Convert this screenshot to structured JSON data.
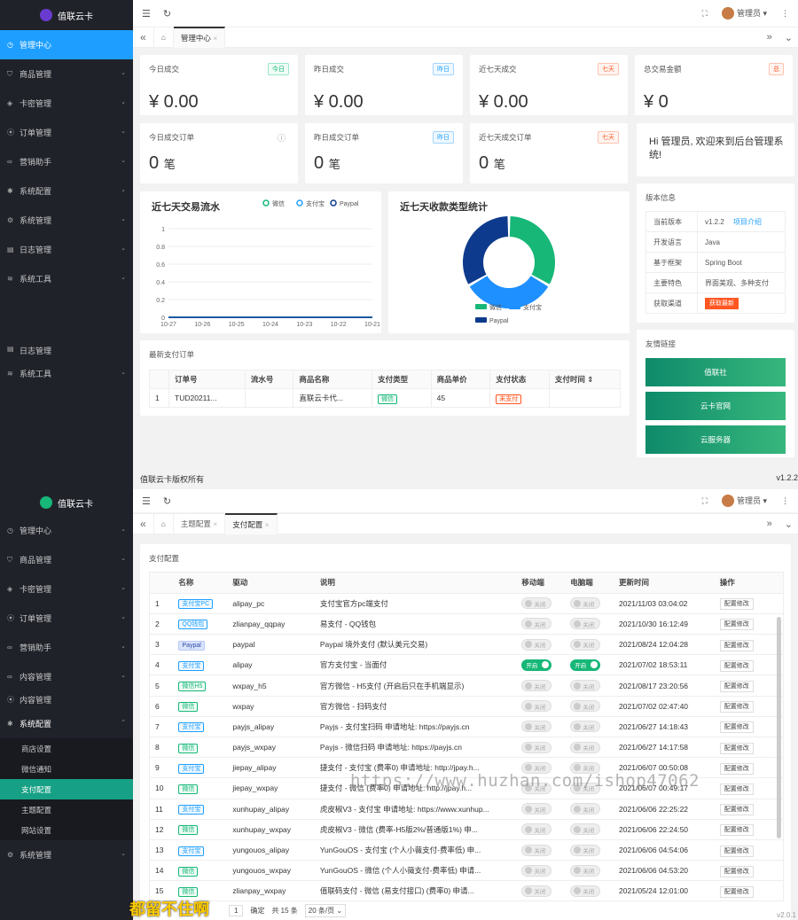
{
  "p1": {
    "brand": "值联云卡",
    "nav": [
      {
        "label": "管理中心",
        "icon": "◷"
      },
      {
        "label": "商品管理",
        "icon": "⛉"
      },
      {
        "label": "卡密管理",
        "icon": "◈"
      },
      {
        "label": "订单管理",
        "icon": "⦿"
      },
      {
        "label": "营销助手",
        "icon": "∞"
      },
      {
        "label": "系统配置",
        "icon": "✱"
      },
      {
        "label": "系统管理",
        "icon": "⚙"
      },
      {
        "label": "日志管理",
        "icon": "▤"
      },
      {
        "label": "系统工具",
        "icon": "≋"
      }
    ],
    "nav_cut": "日志管理",
    "nav_last": {
      "label": "系统工具",
      "icon": "≋"
    },
    "admin": "管理员",
    "tab": "管理中心",
    "stats": [
      {
        "title": "今日成交",
        "badge": "今日",
        "value": "¥ 0.00"
      },
      {
        "title": "昨日成交",
        "badge": "昨日",
        "value": "¥ 0.00"
      },
      {
        "title": "近七天成交",
        "badge": "七天",
        "value": "¥ 0.00"
      },
      {
        "title": "总交易金额",
        "badge": "总",
        "value": "¥ 0"
      }
    ],
    "orders": [
      {
        "title": "今日成交订单",
        "badge": "ⓘ",
        "value": "0",
        "unit": "笔"
      },
      {
        "title": "昨日成交订单",
        "badge": "昨日",
        "value": "0",
        "unit": "笔"
      },
      {
        "title": "近七天成交订单",
        "badge": "七天",
        "value": "0",
        "unit": "笔"
      }
    ],
    "welcome": "Hi 管理员, 欢迎来到后台管理系统!",
    "version_title": "版本信息",
    "version": [
      {
        "k": "当前版本",
        "v": "v1.2.2",
        "link": "项目介绍"
      },
      {
        "k": "开发语言",
        "v": "Java"
      },
      {
        "k": "基于框架",
        "v": "Spring Boot"
      },
      {
        "k": "主要特色",
        "v": "界面美观、多种支付"
      },
      {
        "k": "获取渠道",
        "btn": "获取最新"
      }
    ],
    "links_title": "友情链接",
    "links": [
      "值联社",
      "云卡官网",
      "云服务器"
    ],
    "chart1_title": "近七天交易流水",
    "chart2_title": "近七天收款类型统计",
    "footer": "值联云卡版权所有",
    "footer_ver": "v1.2.2",
    "recent_title": "最新支付订单",
    "recent_cols": [
      "订单号",
      "流水号",
      "商品名称",
      "支付类型",
      "商品单价",
      "支付状态",
      "支付时间 ⇕"
    ],
    "recent_rows": [
      {
        "no": "1",
        "order": "TUD20211...",
        "flow": "",
        "goods": "直联云卡代...",
        "type": "微信",
        "price": "45",
        "status": "未支付",
        "time": ""
      }
    ]
  },
  "chart_data": [
    {
      "type": "line",
      "title": "近七天交易流水",
      "categories": [
        "10-27",
        "10-26",
        "10-25",
        "10-24",
        "10-23",
        "10-22",
        "10-21"
      ],
      "series": [
        {
          "name": "微信",
          "values": [
            0,
            0,
            0,
            0,
            0,
            0,
            0
          ]
        },
        {
          "name": "支付宝",
          "values": [
            0,
            0,
            0,
            0,
            0,
            0,
            0
          ]
        },
        {
          "name": "Paypal",
          "values": [
            0,
            0,
            0,
            0,
            0,
            0,
            0
          ]
        }
      ],
      "ylim": [
        0,
        1
      ],
      "yticks": [
        "0",
        "0.2",
        "0.4",
        "0.6",
        "0.8",
        "1"
      ],
      "legend": "top-right",
      "colors": [
        "#16b777",
        "#1e9fff",
        "#0d3a8c"
      ]
    },
    {
      "type": "pie",
      "title": "近七天收款类型统计",
      "series": [
        {
          "name": "微信",
          "value": 1
        },
        {
          "name": "支付宝",
          "value": 1
        },
        {
          "name": "Paypal",
          "value": 1
        }
      ],
      "legend": "bottom",
      "colors": [
        "#16b777",
        "#1e90ff",
        "#0d3a8c"
      ]
    }
  ],
  "p2": {
    "brand": "值联云卡",
    "nav": [
      {
        "label": "管理中心",
        "icon": "◷"
      },
      {
        "label": "商品管理",
        "icon": "⛉"
      },
      {
        "label": "卡密管理",
        "icon": "◈"
      },
      {
        "label": "订单管理",
        "icon": "⦿"
      },
      {
        "label": "营销助手",
        "icon": "∞"
      },
      {
        "label": "内容管理",
        "icon": "∞"
      },
      {
        "label": "内容管理",
        "icon": "⦿"
      }
    ],
    "nav_open": {
      "label": "系统配置",
      "icon": "✱"
    },
    "sub": [
      "商店设置",
      "微信通知",
      "支付配置",
      "主题配置",
      "网站设置"
    ],
    "nav_end": {
      "label": "系统管理",
      "icon": "⚙"
    },
    "admin": "管理员",
    "tabs": [
      "主题配置",
      "支付配置"
    ],
    "panel_title": "支付配置",
    "cols": [
      "名称",
      "驱动",
      "说明",
      "移动端",
      "电脑端",
      "更新时间",
      "操作"
    ],
    "rows": [
      {
        "n": "1",
        "name": "支付宝PC",
        "c": "b",
        "drv": "alipay_pc",
        "desc": "支付宝官方pc端支付",
        "m": "关闭",
        "p": "关闭",
        "on": false,
        "t": "2021/11/03 03:04:02"
      },
      {
        "n": "2",
        "name": "QQ钱包",
        "c": "b",
        "drv": "zlianpay_qqpay",
        "desc": "易支付 - QQ钱包",
        "m": "关闭",
        "p": "关闭",
        "on": false,
        "t": "2021/10/30 16:12:49"
      },
      {
        "n": "3",
        "name": "Paypal",
        "c": "d",
        "drv": "paypal",
        "desc": "Paypal 境外支付 (默认美元交易)",
        "m": "关闭",
        "p": "关闭",
        "on": false,
        "t": "2021/08/24 12:04:28"
      },
      {
        "n": "4",
        "name": "支付宝",
        "c": "b",
        "drv": "alipay",
        "desc": "官方支付宝 - 当面付",
        "m": "开启",
        "p": "开启",
        "on": true,
        "t": "2021/07/02 18:53:11"
      },
      {
        "n": "5",
        "name": "微信H5",
        "c": "g",
        "drv": "wxpay_h5",
        "desc": "官方微信 - H5支付 (开启后只在手机端显示)",
        "m": "关闭",
        "p": "关闭",
        "on": false,
        "t": "2021/08/17 23:20:56"
      },
      {
        "n": "6",
        "name": "微信",
        "c": "g",
        "drv": "wxpay",
        "desc": "官方微信 - 扫码支付",
        "m": "关闭",
        "p": "关闭",
        "on": false,
        "t": "2021/07/02 02:47:40"
      },
      {
        "n": "7",
        "name": "支付宝",
        "c": "b",
        "drv": "payjs_alipay",
        "desc": "Payjs - 支付宝扫码 申请地址: https://payjs.cn",
        "m": "关闭",
        "p": "关闭",
        "on": false,
        "t": "2021/06/27 14:18:43"
      },
      {
        "n": "8",
        "name": "微信",
        "c": "g",
        "drv": "payjs_wxpay",
        "desc": "Payjs - 微信扫码 申请地址: https://payjs.cn",
        "m": "关闭",
        "p": "关闭",
        "on": false,
        "t": "2021/06/27 14:17:58"
      },
      {
        "n": "9",
        "name": "支付宝",
        "c": "b",
        "drv": "jiepay_alipay",
        "desc": "捷支付 - 支付宝 (费率0) 申请地址: http://jpay.h...",
        "m": "关闭",
        "p": "关闭",
        "on": false,
        "t": "2021/06/07 00:50:08"
      },
      {
        "n": "10",
        "name": "微信",
        "c": "g",
        "drv": "jiepay_wxpay",
        "desc": "捷支付 - 微信 (费率0) 申请地址: http://jpay.h...",
        "m": "关闭",
        "p": "关闭",
        "on": false,
        "t": "2021/06/07 00:49:17"
      },
      {
        "n": "11",
        "name": "支付宝",
        "c": "b",
        "drv": "xunhupay_alipay",
        "desc": "虎皮椒V3 - 支付宝 申请地址: https://www.xunhup...",
        "m": "关闭",
        "p": "关闭",
        "on": false,
        "t": "2021/06/06 22:25:22"
      },
      {
        "n": "12",
        "name": "微信",
        "c": "g",
        "drv": "xunhupay_wxpay",
        "desc": "虎皮椒V3 - 微信 (费率-H5版2%/普通版1%) 申...",
        "m": "关闭",
        "p": "关闭",
        "on": false,
        "t": "2021/06/06 22:24:50"
      },
      {
        "n": "13",
        "name": "支付宝",
        "c": "b",
        "drv": "yungouos_alipay",
        "desc": "YunGouOS - 支付宝 (个人小薇支付-费率低) 申...",
        "m": "关闭",
        "p": "关闭",
        "on": false,
        "t": "2021/06/06 04:54:06"
      },
      {
        "n": "14",
        "name": "微信",
        "c": "g",
        "drv": "yungouos_wxpay",
        "desc": "YunGouOS - 微信 (个人小薇支付-费率低) 申请...",
        "m": "关闭",
        "p": "关闭",
        "on": false,
        "t": "2021/06/06 04:53:20"
      },
      {
        "n": "15",
        "name": "微信",
        "c": "g",
        "drv": "zlianpay_wxpay",
        "desc": "值联码支付 - 微信 (易支付接口) (费率0) 申请...",
        "m": "关闭",
        "p": "关闭",
        "on": false,
        "t": "2021/05/24 12:01:00"
      }
    ],
    "op_label": "配置修改",
    "pager": {
      "page": "1",
      "goto": "确定",
      "total": "共 15 条",
      "size": "20 条/页"
    },
    "footer_ver": "v2.0.1"
  },
  "watermark": "https://www.huzhan.com/ishop47062",
  "overlay_text": "都留不住啊"
}
